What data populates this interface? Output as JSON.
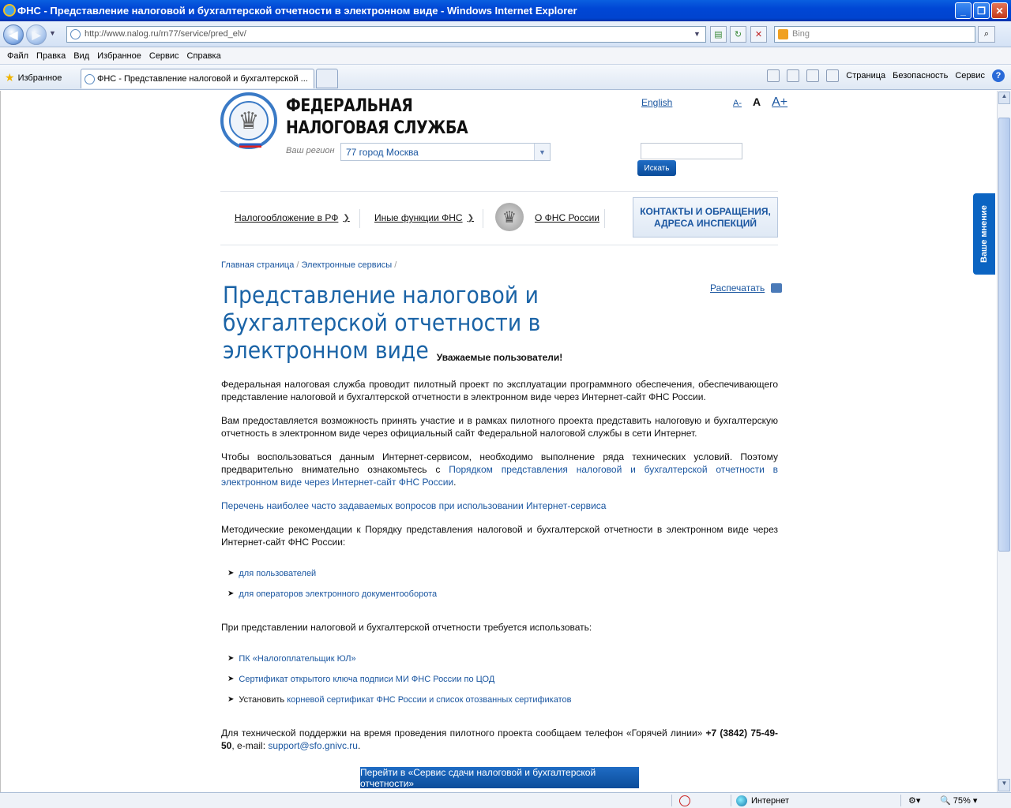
{
  "window": {
    "title": "ФНС - Представление налоговой и бухгалтерской отчетности в электронном виде - Windows Internet Explorer"
  },
  "browser": {
    "url": "http://www.nalog.ru/rn77/service/pred_elv/",
    "search_placeholder": "Bing",
    "menu": [
      "Файл",
      "Правка",
      "Вид",
      "Избранное",
      "Сервис",
      "Справка"
    ],
    "favorites_label": "Избранное",
    "tab_title": "ФНС - Представление налоговой и бухгалтерской ...",
    "commands": {
      "page": "Страница",
      "security": "Безопасность",
      "tools": "Сервис"
    },
    "status": {
      "zone": "Интернет",
      "zoom": "75%"
    }
  },
  "header": {
    "org_line1": "ФЕДЕРАЛЬНАЯ",
    "org_line2": "НАЛОГОВАЯ СЛУЖБА",
    "region_label": "Ваш регион",
    "region_value": "77 город Москва",
    "english": "English",
    "font_small": "A-",
    "font_medium": "A",
    "font_large": "A+",
    "search_button": "Искать"
  },
  "nav": {
    "taxation": "Налогообложение в РФ",
    "other": "Иные функции ФНС",
    "about": "О ФНС России",
    "contacts_line1": "КОНТАКТЫ И ОБРАЩЕНИЯ,",
    "contacts_line2": "АДРЕСА ИНСПЕКЦИЙ"
  },
  "breadcrumbs": {
    "home": "Главная страница",
    "services": "Электронные сервисы"
  },
  "page": {
    "title": "Представление налоговой и бухгалтерской отчетности в электронном виде",
    "print": "Распечатать",
    "greeting": "Уважаемые пользователи!",
    "p1": "Федеральная налоговая служба проводит пилотный проект по эксплуатации программного обеспечения, обеспечивающего представление налоговой и бухгалтерской отчетности в электронном виде через Интернет-сайт ФНС России.",
    "p2": "Вам предоставляется возможность принять участие и в рамках пилотного проекта представить налоговую и бухгалтерскую отчетность в электронном виде через официальный сайт Федеральной налоговой службы в сети Интернет.",
    "p3_text": "Чтобы воспользоваться данным Интернет-сервисом, необходимо выполнение ряда технических условий. Поэтому предварительно внимательно ознакомьтесь с ",
    "p3_link": "Порядком представления налоговой и бухгалтерской отчетности в электронном виде через Интернет-сайт ФНС России",
    "faq_link": "Перечень наиболее часто задаваемых вопросов при использовании Интернет-сервиса",
    "p4": "Методические рекомендации к Порядку представления налоговой и бухгалтерской отчетности в электронном виде через Интернет-сайт ФНС России:",
    "method_links": [
      "для пользователей",
      "для операторов электронного документооборота"
    ],
    "p5": "При представлении налоговой и бухгалтерской отчетности требуется использовать:",
    "req_link1": "ПК «Налогоплательщик ЮЛ»",
    "req_link2": "Сертификат открытого ключа подписи МИ ФНС России по ЦОД",
    "req3_text": "Установить ",
    "req3_link": "корневой сертификат ФНС России и список отозванных сертификатов",
    "support_text": "Для технической поддержки на время проведения пилотного проекта сообщаем телефон «Горячей линии» ",
    "support_phone": "+7 (3842) 75-49-50",
    "support_mid": ", e-mail: ",
    "support_email": "support@sfo.gnivc.ru",
    "go_button": "Перейти в «Сервис сдачи налоговой и бухгалтерской отчетности»",
    "feedback": "Ваше мнение"
  }
}
